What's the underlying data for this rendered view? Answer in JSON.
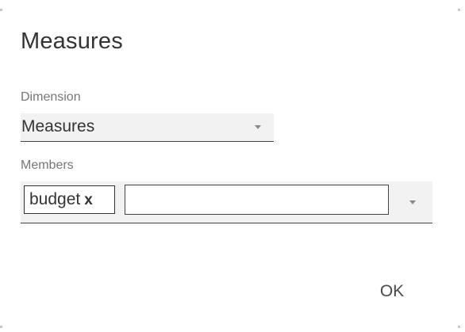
{
  "dialog": {
    "title": "Measures",
    "ok_label": "OK"
  },
  "dimension": {
    "label": "Dimension",
    "selected": "Measures"
  },
  "members": {
    "label": "Members",
    "tokens": [
      {
        "label": "budget",
        "remove_glyph": "x"
      }
    ],
    "input_value": ""
  },
  "icons": {
    "dropdown": "chevron-down-icon",
    "remove": "close-icon"
  }
}
